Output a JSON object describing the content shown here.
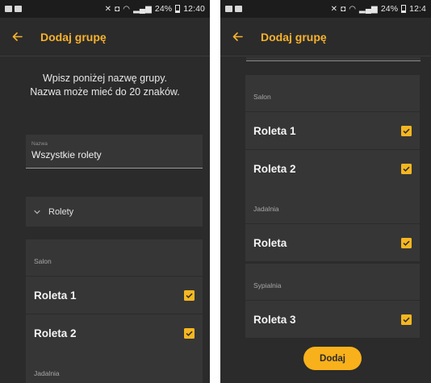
{
  "status_bar": {
    "battery": "24%",
    "time_left": "12:40",
    "time_right": "12:4"
  },
  "app_bar": {
    "title": "Dodaj grupę"
  },
  "instructions": {
    "line1": "Wpisz poniżej nazwę grupy.",
    "line2": "Nazwa może mieć do 20 znaków."
  },
  "name_field": {
    "label": "Nazwa",
    "value": "Wszystkie rolety"
  },
  "dropdown": {
    "label": "Rolety"
  },
  "rooms_left": [
    {
      "title": "Salon",
      "items": [
        {
          "label": "Roleta 1",
          "checked": true
        },
        {
          "label": "Roleta 2",
          "checked": true
        }
      ]
    },
    {
      "title": "Jadalnia",
      "items": []
    }
  ],
  "rooms_right": [
    {
      "title": "Salon",
      "items": [
        {
          "label": "Roleta 1",
          "checked": true
        },
        {
          "label": "Roleta 2",
          "checked": true
        }
      ]
    },
    {
      "title": "Jadalnia",
      "items": [
        {
          "label": "Roleta",
          "checked": true
        }
      ]
    },
    {
      "title": "Sypialnia",
      "items": [
        {
          "label": "Roleta 3",
          "checked": true
        }
      ]
    }
  ],
  "add_button": {
    "label": "Dodaj"
  },
  "colors": {
    "accent": "#f7b22c",
    "background": "#2b2b2b",
    "card": "#363636",
    "status_bar": "#1c1c1c"
  }
}
